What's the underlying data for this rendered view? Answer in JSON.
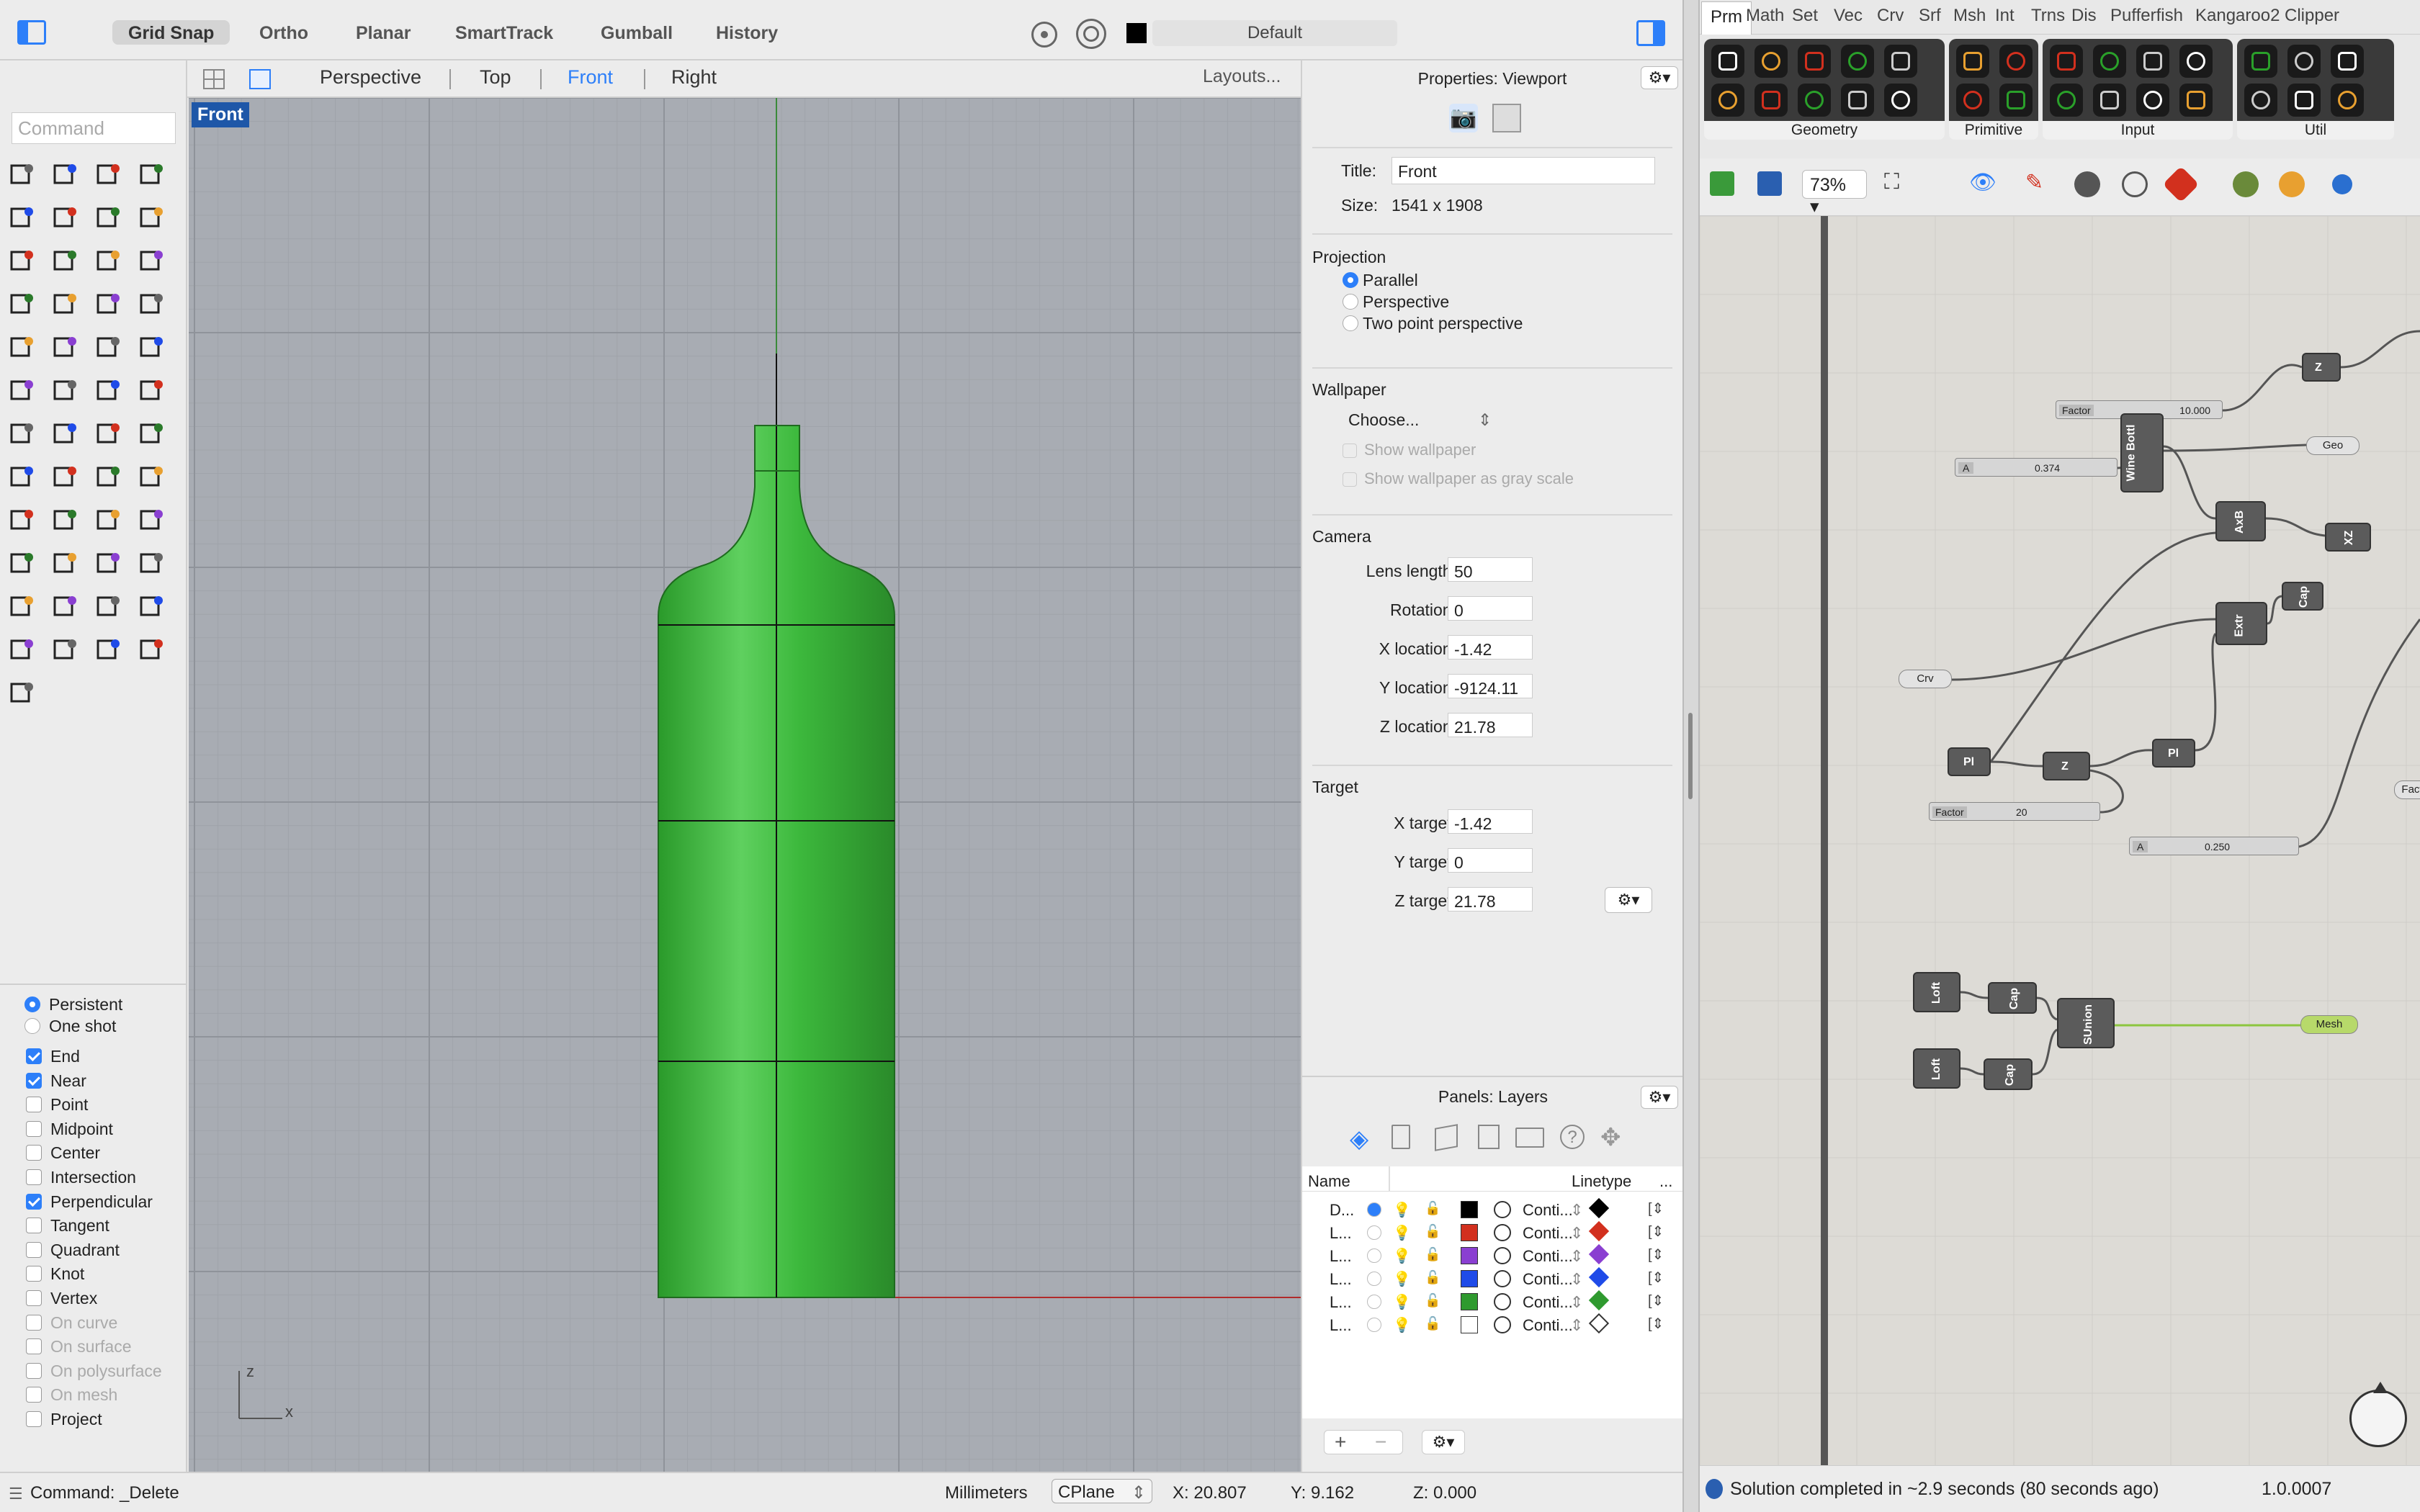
{
  "toolbar": {
    "grid_snap": "Grid Snap",
    "ortho": "Ortho",
    "planar": "Planar",
    "smarttrack": "SmartTrack",
    "gumball": "Gumball",
    "history": "History",
    "layer_name": "Default"
  },
  "view_tabs": {
    "perspective": "Perspective",
    "top": "Top",
    "front": "Front",
    "right": "Right",
    "layouts": "Layouts..."
  },
  "command": {
    "placeholder": "Command"
  },
  "viewport": {
    "label": "Front",
    "axis_z": "z",
    "axis_x": "x"
  },
  "osnap": {
    "persistent": "Persistent",
    "one_shot": "One shot",
    "items": [
      {
        "label": "End",
        "checked": true,
        "enabled": true
      },
      {
        "label": "Near",
        "checked": true,
        "enabled": true
      },
      {
        "label": "Point",
        "checked": false,
        "enabled": true
      },
      {
        "label": "Midpoint",
        "checked": false,
        "enabled": true
      },
      {
        "label": "Center",
        "checked": false,
        "enabled": true
      },
      {
        "label": "Intersection",
        "checked": false,
        "enabled": true
      },
      {
        "label": "Perpendicular",
        "checked": true,
        "enabled": true
      },
      {
        "label": "Tangent",
        "checked": false,
        "enabled": true
      },
      {
        "label": "Quadrant",
        "checked": false,
        "enabled": true
      },
      {
        "label": "Knot",
        "checked": false,
        "enabled": true
      },
      {
        "label": "Vertex",
        "checked": false,
        "enabled": true
      },
      {
        "label": "On curve",
        "checked": false,
        "enabled": false
      },
      {
        "label": "On surface",
        "checked": false,
        "enabled": false
      },
      {
        "label": "On polysurface",
        "checked": false,
        "enabled": false
      },
      {
        "label": "On mesh",
        "checked": false,
        "enabled": false
      },
      {
        "label": "Project",
        "checked": false,
        "enabled": true
      }
    ]
  },
  "properties": {
    "header": "Properties: Viewport",
    "title_label": "Title:",
    "title_value": "Front",
    "size_label": "Size:",
    "size_value": "1541 x 1908",
    "projection": "Projection",
    "proj_parallel": "Parallel",
    "proj_perspective": "Perspective",
    "proj_two_point": "Two point perspective",
    "wallpaper": "Wallpaper",
    "choose": "Choose...",
    "show_wallpaper": "Show wallpaper",
    "show_gray": "Show wallpaper as gray scale",
    "camera": "Camera",
    "lens_label": "Lens length:",
    "lens_value": "50",
    "rotation_label": "Rotation:",
    "rotation_value": "0",
    "xloc_label": "X location:",
    "xloc_value": "-1.42",
    "yloc_label": "Y location:",
    "yloc_value": "-9124.11",
    "zloc_label": "Z location:",
    "zloc_value": "21.78",
    "target": "Target",
    "xt_label": "X target:",
    "xt_value": "-1.42",
    "yt_label": "Y target:",
    "yt_value": "0",
    "zt_label": "Z target:",
    "zt_value": "21.78"
  },
  "layers": {
    "header": "Panels: Layers",
    "col_name": "Name",
    "col_linetype": "Linetype",
    "col_more": "...",
    "rows": [
      {
        "name": "D...",
        "color": "#000000",
        "linetype": "Conti...",
        "current": true
      },
      {
        "name": "L...",
        "color": "#d2301e",
        "linetype": "Conti...",
        "current": false
      },
      {
        "name": "L...",
        "color": "#8a3fd1",
        "linetype": "Conti...",
        "current": false
      },
      {
        "name": "L...",
        "color": "#1f4be8",
        "linetype": "Conti...",
        "current": false
      },
      {
        "name": "L...",
        "color": "#2f9a2f",
        "linetype": "Conti...",
        "current": false
      },
      {
        "name": "L...",
        "color": "#ffffff",
        "linetype": "Conti...",
        "current": false
      }
    ]
  },
  "status": {
    "command": "Command: _Delete",
    "units": "Millimeters",
    "cplane": "CPlane",
    "x": "X: 20.807",
    "y": "Y: 9.162",
    "z": "Z: 0.000"
  },
  "grasshopper": {
    "tabs": [
      "Prm",
      "Math",
      "Set",
      "Vec",
      "Crv",
      "Srf",
      "Msh",
      "Int",
      "Trns",
      "Dis",
      "Pufferfish",
      "Kangaroo2",
      "Clipper"
    ],
    "active_tab": "Prm",
    "groups": [
      "Geometry",
      "Primitive",
      "Input",
      "Util"
    ],
    "zoom": "73%",
    "status": "Solution completed in ~2.9 seconds (80 seconds ago)",
    "version": "1.0.0007",
    "nodes": {
      "wine_bottle": "Wine Bottl",
      "factor1_label": "Factor",
      "factor1_value": "10.000",
      "a1_label": "A",
      "a1_value": "0.374",
      "z1": "Z",
      "geo": "Geo",
      "axb": "AxB",
      "xz": "XZ",
      "cap1": "Cap",
      "extr": "Extr",
      "crv": "Crv",
      "pl1": "Pl",
      "z2": "Z",
      "pl2": "Pl",
      "factor2_label": "Factor",
      "factor2_value": "20",
      "a2_label": "A",
      "a2_value": "0.250",
      "fact": "Fact",
      "loft1": "Loft",
      "loft2": "Loft",
      "cap2": "Cap",
      "cap3": "Cap",
      "sunion": "SUnion",
      "mesh": "Mesh"
    }
  }
}
